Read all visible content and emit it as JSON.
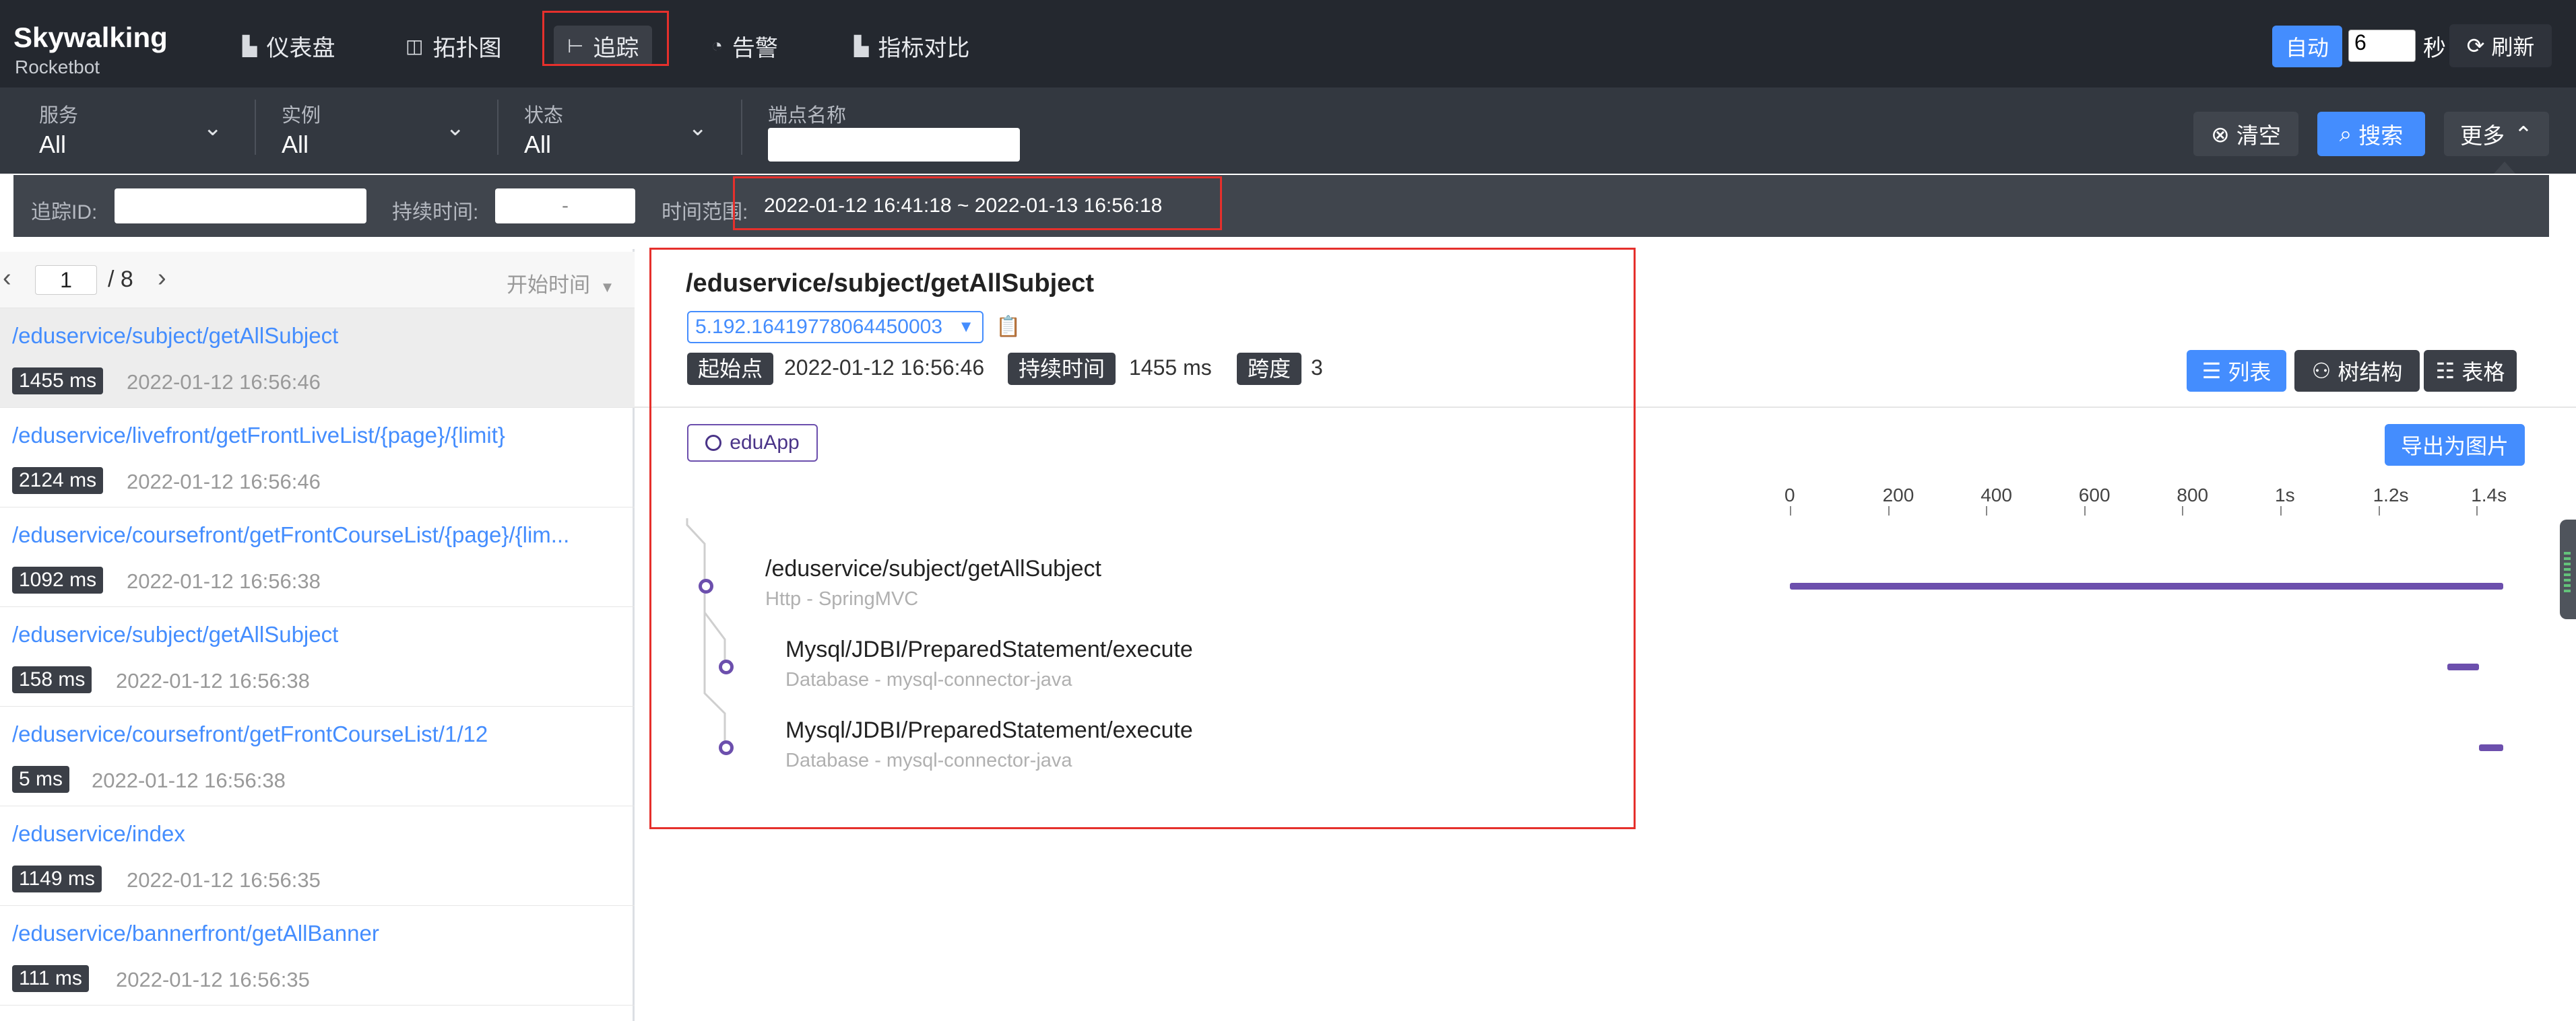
{
  "app": {
    "logo_name": "Skywalking",
    "logo_sub": "Rocketbot"
  },
  "nav": {
    "items": [
      {
        "label": "仪表盘",
        "icon": "chart-icon"
      },
      {
        "label": "拓扑图",
        "icon": "topology-icon"
      },
      {
        "label": "追踪",
        "icon": "trace-icon",
        "active": true
      },
      {
        "label": "告警",
        "icon": "alert-icon"
      },
      {
        "label": "指标对比",
        "icon": "compare-icon"
      }
    ],
    "auto_label": "自动",
    "auto_interval": "6",
    "seconds_label": "秒",
    "refresh_label": "刷新"
  },
  "filters": {
    "service": {
      "label": "服务",
      "value": "All"
    },
    "instance": {
      "label": "实例",
      "value": "All"
    },
    "status": {
      "label": "状态",
      "value": "All"
    },
    "endpoint": {
      "label": "端点名称",
      "value": ""
    },
    "clear_label": "清空",
    "search_label": "搜索",
    "more_label": "更多"
  },
  "trace_filter": {
    "trace_id_label": "追踪ID:",
    "trace_id_value": "",
    "duration_label": "持续时间:",
    "duration_value": "-",
    "time_range_label": "时间范围:",
    "time_range_value": "2022-01-12 16:41:18 ~ 2022-01-13 16:56:18"
  },
  "list": {
    "page": "1",
    "total_pages": "/ 8",
    "sort_label": "开始时间",
    "traces": [
      {
        "path": "/eduservice/subject/getAllSubject",
        "duration": "1455 ms",
        "time": "2022-01-12 16:56:46",
        "selected": true
      },
      {
        "path": "/eduservice/livefront/getFrontLiveList/{page}/{limit}",
        "duration": "2124 ms",
        "time": "2022-01-12 16:56:46"
      },
      {
        "path": "/eduservice/coursefront/getFrontCourseList/{page}/{lim...",
        "duration": "1092 ms",
        "time": "2022-01-12 16:56:38"
      },
      {
        "path": "/eduservice/subject/getAllSubject",
        "duration": "158 ms",
        "time": "2022-01-12 16:56:38"
      },
      {
        "path": "/eduservice/coursefront/getFrontCourseList/1/12",
        "duration": "5 ms",
        "time": "2022-01-12 16:56:38"
      },
      {
        "path": "/eduservice/index",
        "duration": "1149 ms",
        "time": "2022-01-12 16:56:35"
      },
      {
        "path": "/eduservice/bannerfront/getAllBanner",
        "duration": "111 ms",
        "time": "2022-01-12 16:56:35"
      }
    ]
  },
  "detail": {
    "title": "/eduservice/subject/getAllSubject",
    "trace_id": "5.192.16419778064450003",
    "start_label": "起始点",
    "start_value": "2022-01-12 16:56:46",
    "duration_label": "持续时间",
    "duration_value": "1455 ms",
    "span_label": "跨度",
    "span_value": "3",
    "view_list": "列表",
    "view_tree": "树结构",
    "view_table": "表格",
    "app_name": "eduApp",
    "export_label": "导出为图片",
    "axis_ticks": [
      "0",
      "200",
      "400",
      "600",
      "800",
      "1s",
      "1.2s",
      "1.4s"
    ],
    "spans": [
      {
        "name": "/eduservice/subject/getAllSubject",
        "sub": "Http - SpringMVC",
        "start": 0,
        "end": 1455
      },
      {
        "name": "Mysql/JDBI/PreparedStatement/execute",
        "sub": "Database - mysql-connector-java",
        "start": 1340,
        "end": 1405
      },
      {
        "name": "Mysql/JDBI/PreparedStatement/execute",
        "sub": "Database - mysql-connector-java",
        "start": 1405,
        "end": 1455
      }
    ],
    "accent_color": "#448dfe",
    "span_color": "#6c4fad"
  }
}
